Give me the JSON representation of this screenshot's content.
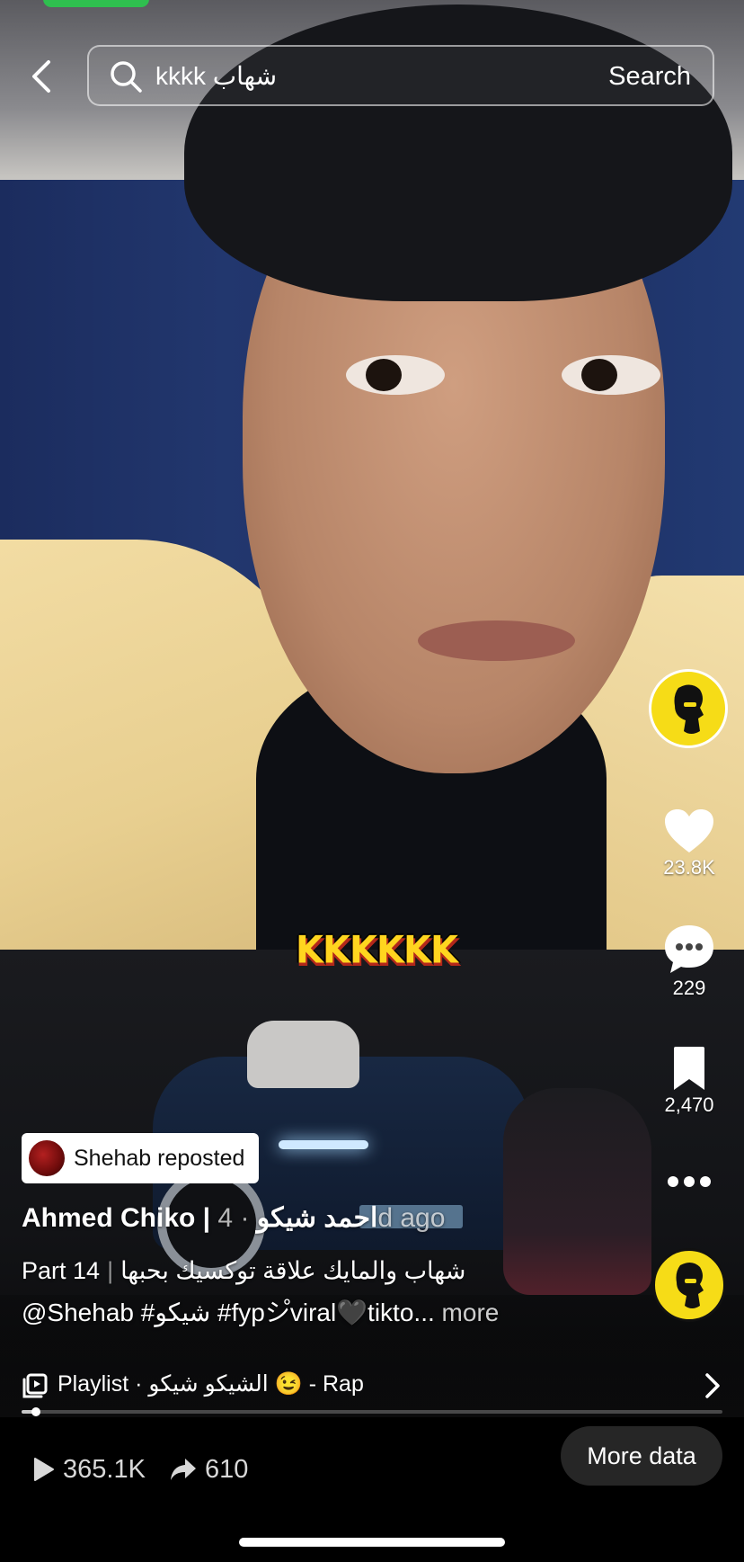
{
  "search": {
    "query": "kkkk شهاب",
    "button_label": "Search"
  },
  "video": {
    "caption_overlay": "KKKKKK"
  },
  "rail": {
    "likes": "23.8K",
    "comments": "229",
    "saves": "2,470"
  },
  "info": {
    "repost_label": "Shehab reposted",
    "author_name": "Ahmed Chiko | احمد شيكو",
    "author_time": " · 4d ago",
    "part_label": "Part 14",
    "description_arabic": "شهاب والمايك علاقة توكسيك بحبها",
    "hashtags": "@Shehab #شيكو #fypシ゚viral🖤tikto...",
    "more_label": " more"
  },
  "playlist": {
    "text": "Playlist · الشيكو شيكو 😉 - Rap"
  },
  "progress": {
    "fraction": 0.02
  },
  "stats": {
    "plays": "365.1K",
    "shares": "610",
    "more_data_label": "More data"
  },
  "colors": {
    "accent_yellow": "#f6dc17",
    "caption_yellow": "#ffd51f",
    "caption_red": "#b3281b"
  },
  "icons": {
    "back": "chevron-left-icon",
    "search": "magnifier-icon",
    "like": "heart-icon",
    "comment": "comment-bubble-icon",
    "save": "bookmark-icon",
    "more": "ellipsis-icon",
    "playlist": "playlist-icon",
    "chevron": "chevron-right-icon",
    "plays": "play-icon",
    "shares": "share-arrow-icon"
  }
}
